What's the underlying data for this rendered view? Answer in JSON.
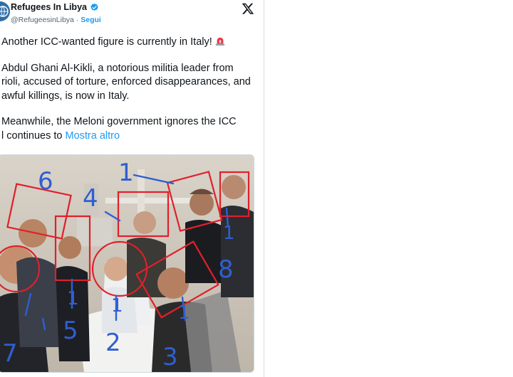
{
  "tweet": {
    "display_name": "Refugees In Libya",
    "handle": "@RefugeesinLibya",
    "separator": "·",
    "follow_label": "Segui",
    "paragraphs": [
      "Another ICC-wanted figure is currently in Italy!",
      "Abdul Ghani Al-Kikli, a notorious militia leader from\nrioli, accused of torture, enforced disappearances, and\nawful killings, is now in Italy.",
      "Meanwhile, the Meloni government ignores the ICC"
    ],
    "last_line_prefix": "l continues to",
    "more_label": "Mostra altro"
  },
  "photo": {
    "annotation_numbers": [
      "1",
      "2",
      "3",
      "4",
      "5",
      "6",
      "7",
      "8",
      "1",
      "1",
      "1",
      "1"
    ],
    "annotation_color": "#2f5fd0",
    "box_color": "#e0202a"
  },
  "icons": {
    "verified": "verified-badge-icon",
    "x": "x-logo-icon",
    "siren": "siren-emoji-icon"
  }
}
